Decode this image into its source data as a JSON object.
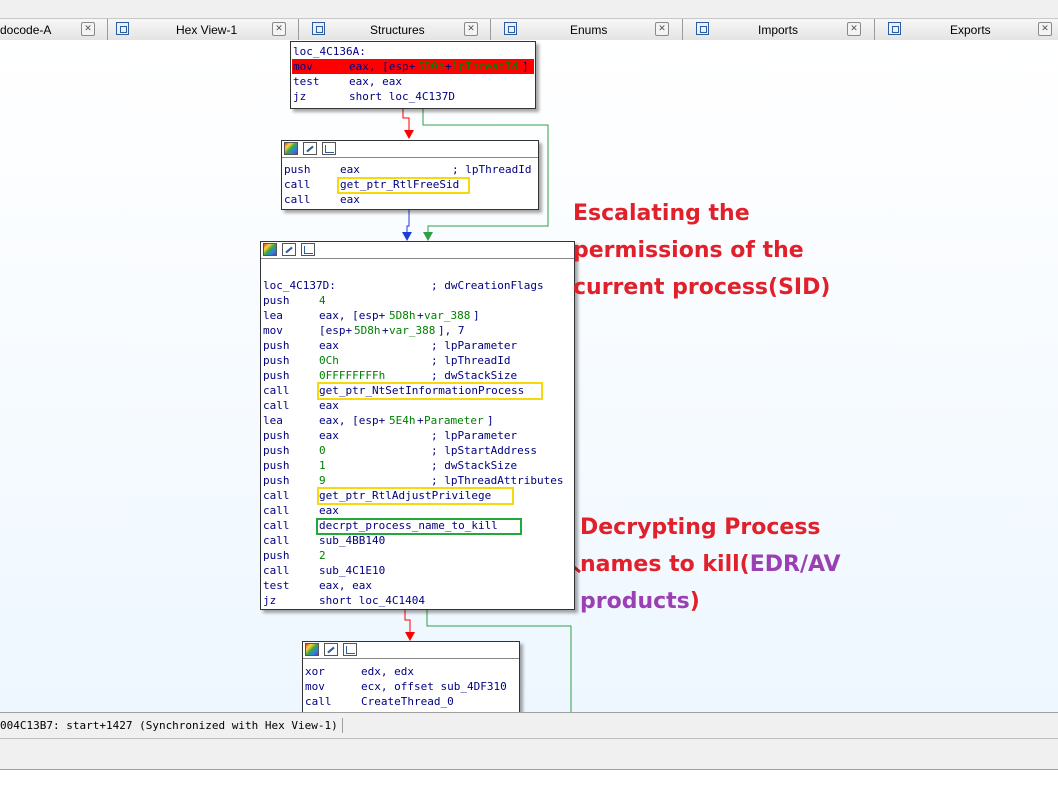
{
  "tabs": [
    {
      "label": "docode-A",
      "icon": "pseudocode-icon"
    },
    {
      "label": "Hex View-1",
      "icon": "hex-view-icon"
    },
    {
      "label": "Structures",
      "icon": "structures-icon"
    },
    {
      "label": "Enums",
      "icon": "enums-icon"
    },
    {
      "label": "Imports",
      "icon": "imports-icon"
    },
    {
      "label": "Exports",
      "icon": "exports-icon"
    }
  ],
  "blocks": {
    "b1": {
      "label": "loc_4C136A:",
      "lines": [
        {
          "mnem": "mov",
          "op1": "eax, [esp+",
          "num": "5D0h",
          "op2": "+",
          "ref": "lpThreadId",
          "op3": "]"
        },
        {
          "mnem": "test",
          "ops": "eax, eax"
        },
        {
          "mnem": "jz",
          "ops": "short loc_4C137D"
        }
      ]
    },
    "b2": {
      "lines": [
        {
          "mnem": "push",
          "ops": "eax",
          "cmt": "; lpThreadId"
        },
        {
          "mnem": "call",
          "ops": "get_ptr_RtlFreeSid"
        },
        {
          "mnem": "call",
          "ops": "eax"
        }
      ]
    },
    "b3": {
      "label": "loc_4C137D:",
      "label_cmt": "; dwCreationFlags",
      "lines": [
        {
          "mnem": "push",
          "num": "4"
        },
        {
          "mnem": "lea",
          "op1": "eax, [esp+",
          "num": "5D8h",
          "op2": "+",
          "ref": "var_388",
          "op3": "]"
        },
        {
          "mnem": "mov",
          "op1": "[esp+",
          "num": "5D8h",
          "op2": "+",
          "ref": "var_388",
          "op3": "], 7"
        },
        {
          "mnem": "push",
          "ops": "eax",
          "cmt": "; lpParameter"
        },
        {
          "mnem": "push",
          "num": "0Ch",
          "cmt": "; lpThreadId"
        },
        {
          "mnem": "push",
          "num": "0FFFFFFFFh",
          "cmt": "; dwStackSize"
        },
        {
          "mnem": "call",
          "ops": "get_ptr_NtSetInformationProcess"
        },
        {
          "mnem": "call",
          "ops": "eax"
        },
        {
          "mnem": "lea",
          "op1": "eax, [esp+",
          "num": "5E4h",
          "op2": "+",
          "ref": "Parameter",
          "op3": "]"
        },
        {
          "mnem": "push",
          "ops": "eax",
          "cmt": "; lpParameter"
        },
        {
          "mnem": "push",
          "num": "0",
          "cmt": "; lpStartAddress"
        },
        {
          "mnem": "push",
          "num": "1",
          "cmt": "; dwStackSize"
        },
        {
          "mnem": "push",
          "num": "9",
          "cmt": "; lpThreadAttributes"
        },
        {
          "mnem": "call",
          "ops": "get_ptr_RtlAdjustPrivilege"
        },
        {
          "mnem": "call",
          "ops": "eax"
        },
        {
          "mnem": "call",
          "ops": "decrpt_process_name_to_kill"
        },
        {
          "mnem": "call",
          "ops": "sub_4BB140"
        },
        {
          "mnem": "push",
          "num": "2"
        },
        {
          "mnem": "call",
          "ops": "sub_4C1E10"
        },
        {
          "mnem": "test",
          "ops": "eax, eax"
        },
        {
          "mnem": "jz",
          "ops": "short loc_4C1404"
        }
      ]
    },
    "b4": {
      "lines": [
        {
          "mnem": "xor",
          "ops": "edx, edx"
        },
        {
          "mnem": "mov",
          "ops": "ecx, offset sub_4DF310"
        },
        {
          "mnem": "call",
          "ops": "CreateThread_0"
        }
      ]
    }
  },
  "annotations": {
    "escalate": [
      "Escalating the",
      "permissions of the",
      "current process(SID)"
    ],
    "decrypt_line1": "Decrypting Process",
    "decrypt_line2a": "names to kill(",
    "decrypt_line2b": "EDR/AV",
    "decrypt_line3a": "products",
    "decrypt_line3b": ")"
  },
  "status": {
    "text": "004C13B7: start+1427 (Synchronized with Hex View-1)"
  },
  "colors": {
    "annotation_red": "#e0202a",
    "annotation_purple": "#9b3fb5",
    "highlight_yellow": "#f5d90a",
    "highlight_green": "#23a83a",
    "edge_red": "#ff0000",
    "edge_green": "#2ea043",
    "edge_blue": "#1a3fd9"
  }
}
